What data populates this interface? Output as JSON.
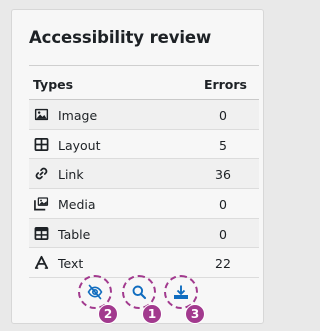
{
  "panel": {
    "title": "Accessibility review"
  },
  "table": {
    "headers": {
      "type": "Types",
      "errors": "Errors"
    },
    "rows": [
      {
        "label": "Image",
        "count": "0",
        "icon": "image-icon"
      },
      {
        "label": "Layout",
        "count": "5",
        "icon": "layout-table-icon"
      },
      {
        "label": "Link",
        "count": "36",
        "icon": "link-icon"
      },
      {
        "label": "Media",
        "count": "0",
        "icon": "media-icon"
      },
      {
        "label": "Table",
        "count": "0",
        "icon": "table-icon"
      },
      {
        "label": "Text",
        "count": "22",
        "icon": "text-icon"
      }
    ]
  },
  "controls": {
    "buttons": [
      {
        "name": "toggle-highlight-button",
        "icon": "eye-slash-icon",
        "badge": "2"
      },
      {
        "name": "search-button",
        "icon": "search-icon",
        "badge": "1"
      },
      {
        "name": "download-report-button",
        "icon": "download-icon",
        "badge": "3"
      }
    ]
  },
  "colors": {
    "accent": "#0f6cbf",
    "annotation": "#a23a8e",
    "text": "#1d2125"
  }
}
